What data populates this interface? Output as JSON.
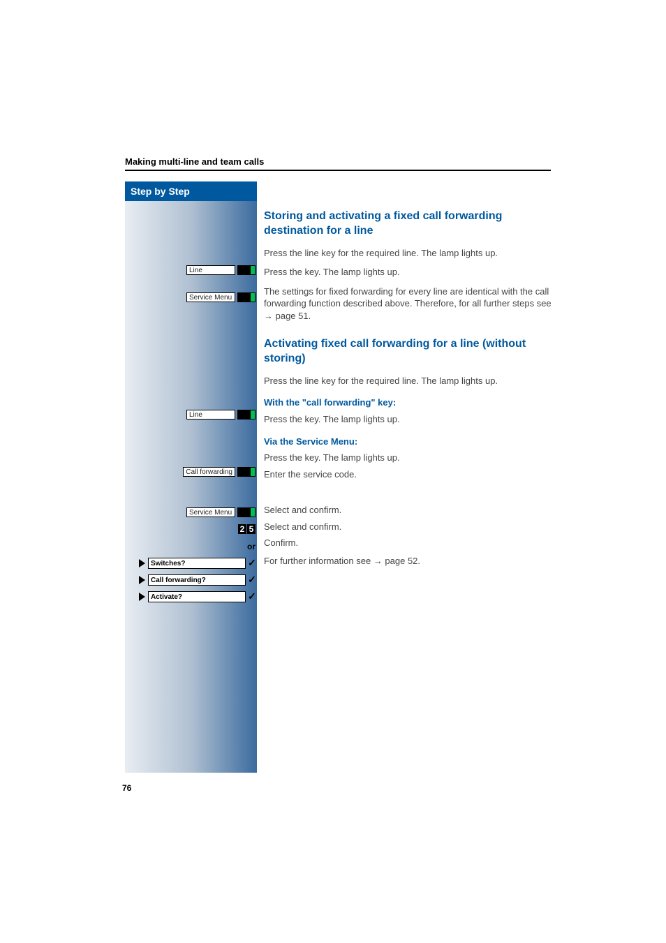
{
  "header": {
    "section": "Making multi-line and team calls"
  },
  "sidebar": {
    "title": "Step by Step",
    "keys": {
      "line": "Line",
      "serviceMenu": "Service Menu",
      "callForwarding": "Call forwarding"
    },
    "code": {
      "d1": "2",
      "d2": "5"
    },
    "or": "or",
    "menu": {
      "switches": "Switches?",
      "callForwarding": "Call forwarding?",
      "activate": "Activate?"
    }
  },
  "content": {
    "h2a": "Storing and activating a fixed call forwarding destination for a line",
    "p1": "Press the line key for the required line. The lamp lights up.",
    "p2": "Press the key. The lamp lights up.",
    "p3a": "The settings for fixed forwarding for every line are identical with the call forwarding function described above. Therefore, for all further steps see ",
    "p3link": "→ page 51.",
    "h2b": "Activating fixed call forwarding for a line (without storing)",
    "p4": "Press the line key for the required line. The lamp lights up.",
    "h3a": "With the \"call forwarding\" key:",
    "p5": "Press the key. The lamp lights up.",
    "h3b": "Via the Service Menu:",
    "p6": "Press the key. The lamp lights up.",
    "p7": "Enter the service code.",
    "p8": "Select and confirm.",
    "p9": "Select and confirm.",
    "p10": "Confirm.",
    "p11a": "For further information see ",
    "p11link": "→ page 52."
  },
  "pageNumber": "76"
}
